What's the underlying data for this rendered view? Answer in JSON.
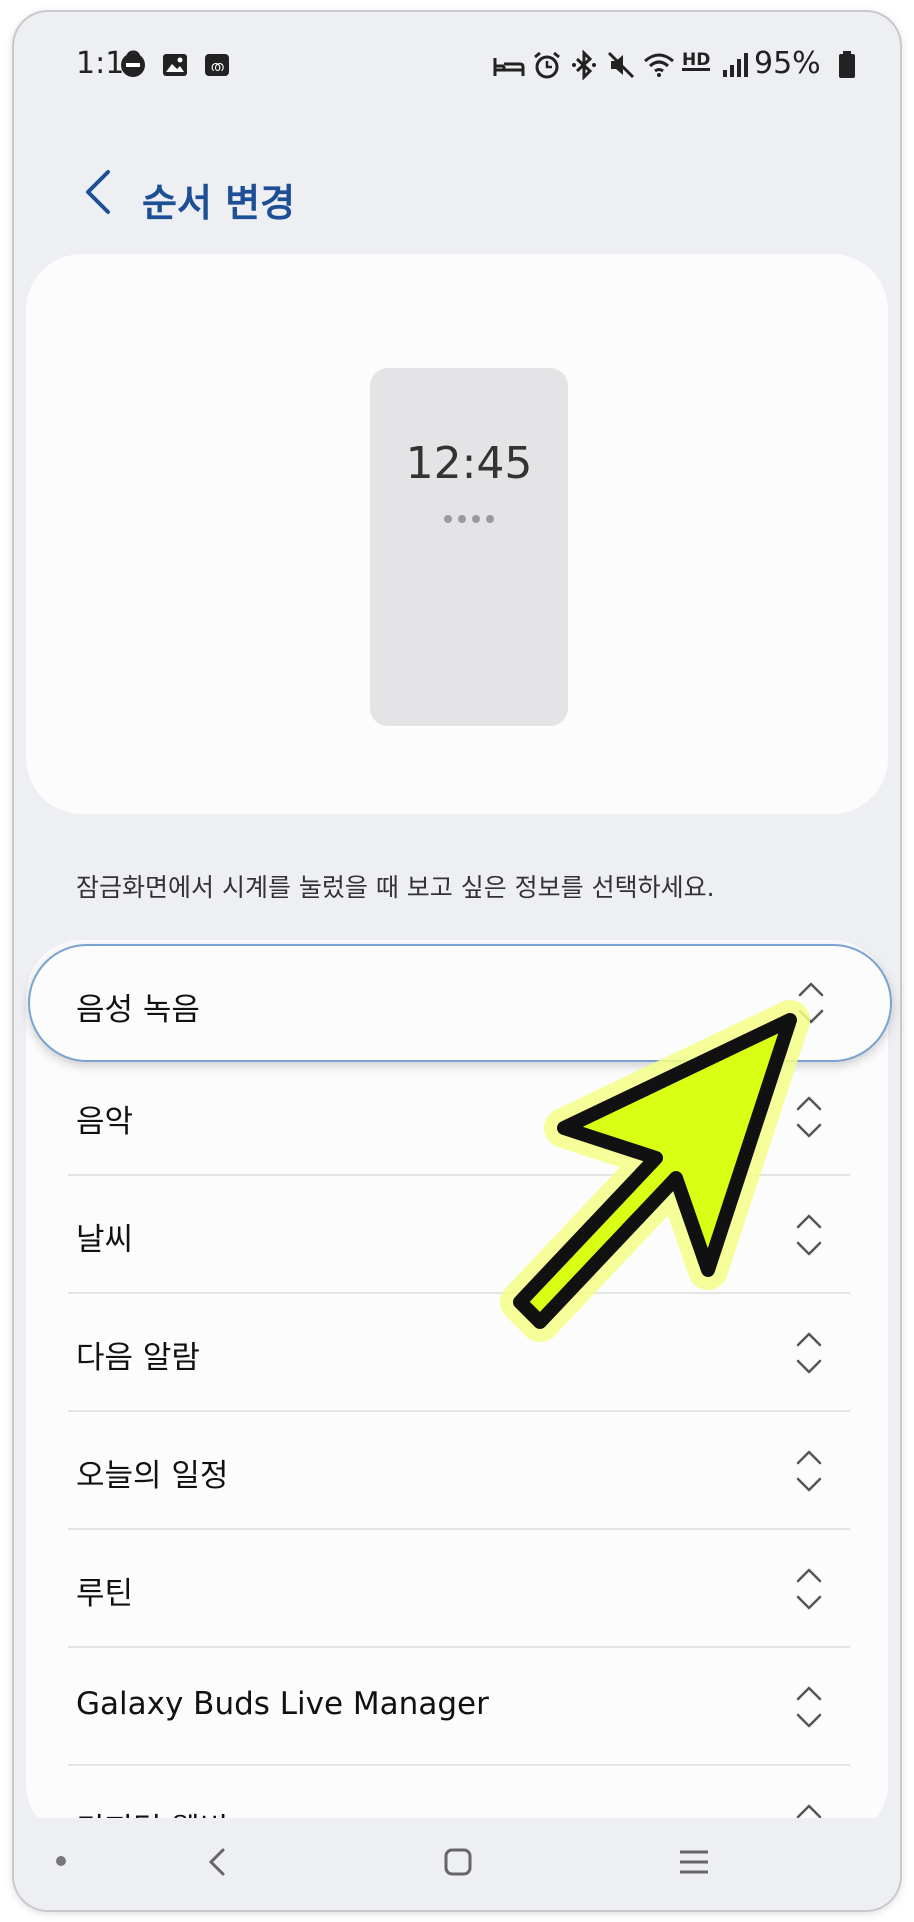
{
  "status_bar": {
    "time": "1:19",
    "battery": "95%",
    "left_icons": [
      "dnd-icon",
      "gallery-icon",
      "app-notification-icon"
    ],
    "right_icons": [
      "sleep-icon",
      "alarm-icon",
      "bluetooth-icon",
      "mute-icon",
      "wifi-icon",
      "hd-voice-icon",
      "signal-icon",
      "battery-icon"
    ],
    "hd_voice": "HD"
  },
  "header": {
    "title": "순서 변경"
  },
  "preview": {
    "clock": "12:45"
  },
  "description": "잠금화면에서 시계를 눌렀을 때 보고 싶은 정보를 선택하세요.",
  "list": {
    "selected": "음성 녹음",
    "items": [
      "음악",
      "날씨",
      "다음 알람",
      "오늘의 일정",
      "루틴",
      "Galaxy Buds Live Manager",
      "디지털 웰빙"
    ]
  },
  "overlay": {
    "arrow_color": "#d8ff14"
  }
}
